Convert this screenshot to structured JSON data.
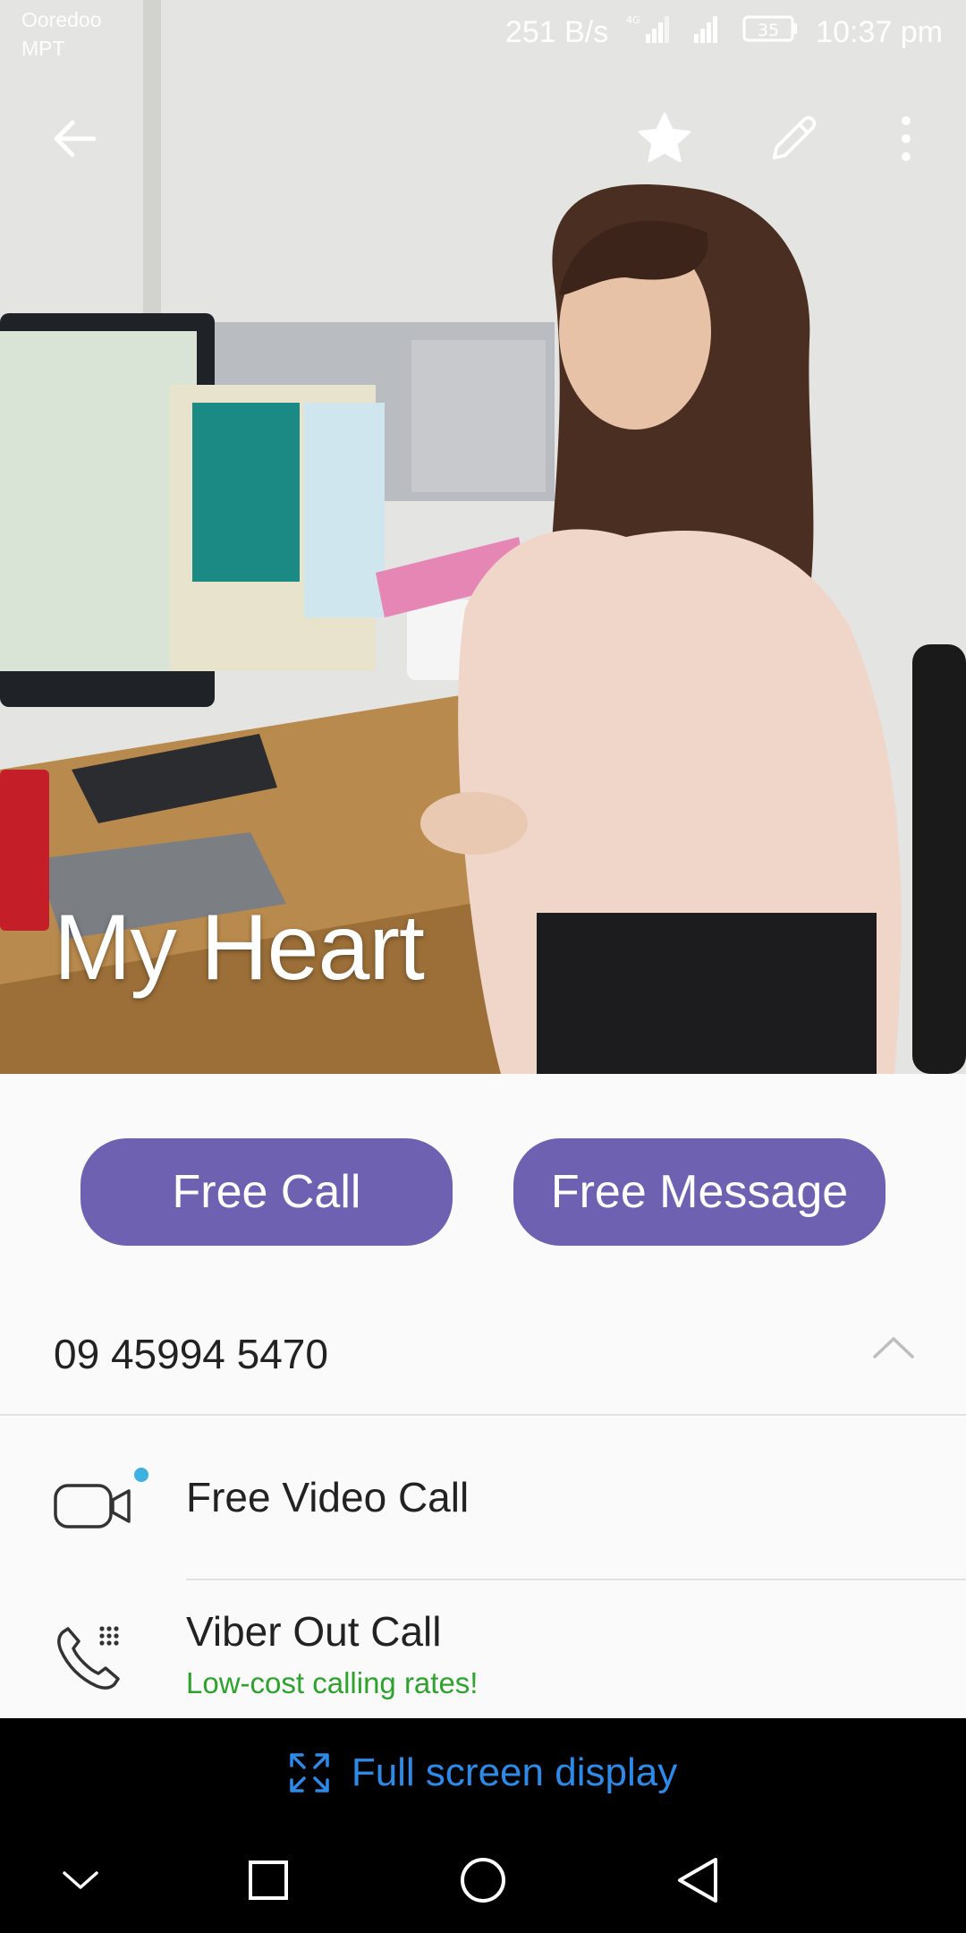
{
  "status_bar": {
    "carrier_line1": "Ooredoo",
    "carrier_line2": "MPT",
    "speed": "251 B/s",
    "network_badge": "4G",
    "battery": "35",
    "time": "10:37 pm"
  },
  "toolbar": {
    "back_icon": "arrow-left-icon",
    "favorite_icon": "star-icon",
    "edit_icon": "pencil-icon",
    "more_icon": "more-vertical-icon"
  },
  "contact": {
    "name": "My Heart",
    "phone": "09 45994 5470"
  },
  "actions": {
    "call_label": "Free Call",
    "message_label": "Free Message"
  },
  "options": [
    {
      "title": "Free Video Call",
      "icon": "video-camera-icon",
      "new_badge": true
    },
    {
      "title": "Viber Out Call",
      "subtitle": "Low-cost calling rates!",
      "icon": "phone-dialpad-icon"
    }
  ],
  "fullscreen": {
    "label": "Full screen display",
    "icon": "expand-icon"
  },
  "colors": {
    "accent_purple": "#6f61b2",
    "subtitle_green": "#2da32d",
    "fullscreen_blue": "#2c8be8",
    "badge_blue": "#3fb1e0"
  }
}
